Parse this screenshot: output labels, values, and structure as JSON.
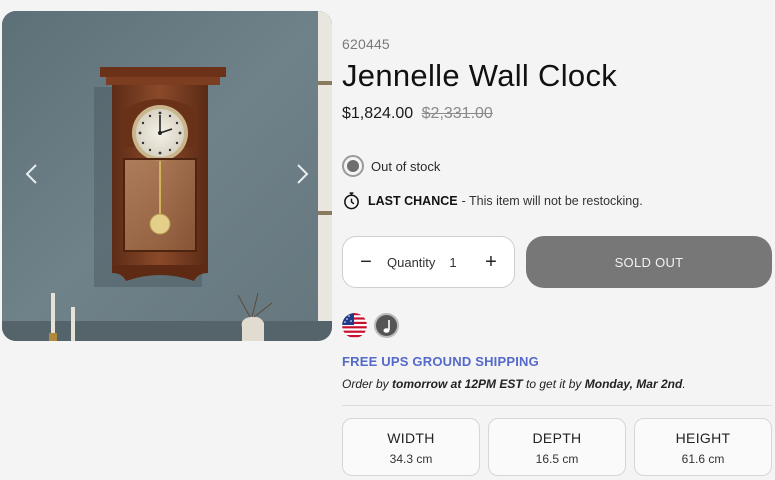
{
  "product": {
    "sku": "620445",
    "title": "Jennelle Wall Clock",
    "price": "$1,824.00",
    "compare_price": "$2,331.00"
  },
  "gallery": {
    "prev_icon": "chevron-left-icon",
    "next_icon": "chevron-right-icon"
  },
  "stock": {
    "status": "Out of stock"
  },
  "last_chance": {
    "icon": "stopwatch-icon",
    "title": "LAST CHANCE",
    "message": "- This item will not be restocking."
  },
  "quantity": {
    "label": "Quantity",
    "value": "1",
    "minus": "−",
    "plus": "+"
  },
  "cta": {
    "label": "SOLD OUT"
  },
  "badges": [
    "usa-flag-icon",
    "music-note-icon"
  ],
  "shipping": {
    "title": "FREE UPS GROUND SHIPPING",
    "line_prefix": "Order by ",
    "line_when": "tomorrow at 12PM EST",
    "line_middle": " to get it by ",
    "line_date": "Monday, Mar 2nd",
    "line_suffix": "."
  },
  "dimensions": [
    {
      "label": "WIDTH",
      "value": "34.3 cm"
    },
    {
      "label": "DEPTH",
      "value": "16.5 cm"
    },
    {
      "label": "HEIGHT",
      "value": "61.6 cm"
    }
  ],
  "colors": {
    "accent": "#5469c9",
    "sold_out_bg": "#777777",
    "wall": "#6b7d84",
    "wood": "#7a3f22"
  }
}
